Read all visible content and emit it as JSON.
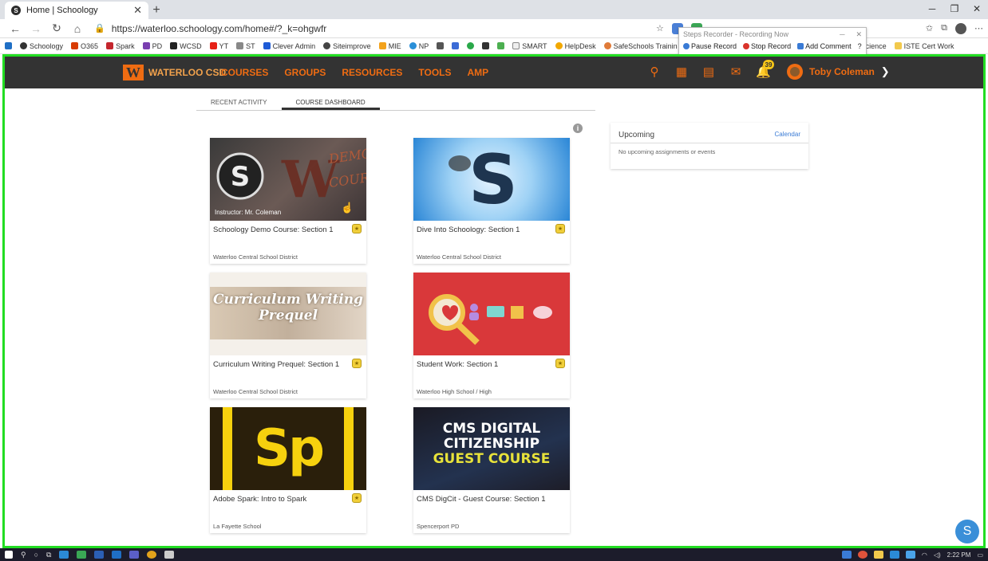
{
  "browser": {
    "tab_title": "Home | Schoology",
    "url": "https://waterloo.schoology.com/home#/?_k=ohgwfr",
    "bookmarks": [
      "Schoology",
      "O365",
      "Spark",
      "PD",
      "WCSD",
      "YT",
      "ST",
      "Clever Admin",
      "Siteimprove",
      "MIE",
      "NP",
      "SMART",
      "HelpDesk",
      "SafeSchools Trainin",
      "Science",
      "ISTE Cert Work"
    ]
  },
  "steps_recorder": {
    "title": "Steps Recorder - Recording Now",
    "pause": "Pause Record",
    "stop": "Stop Record",
    "comment": "Add Comment"
  },
  "header": {
    "logo_text": "WATERLOO CSD",
    "nav": [
      "COURSES",
      "GROUPS",
      "RESOURCES",
      "TOOLS",
      "AMP"
    ],
    "notifications_count": "39",
    "user_name": "Toby Coleman"
  },
  "tabs": [
    "RECENT ACTIVITY",
    "COURSE DASHBOARD"
  ],
  "courses": [
    {
      "title": "Schoology Demo Course: Section 1",
      "org": "Waterloo Central School District",
      "instructor": "Instructor: Mr. Coleman",
      "image": "demo-course"
    },
    {
      "title": "Dive Into Schoology: Section 1",
      "org": "Waterloo Central School District",
      "image": "dive-into-schoology"
    },
    {
      "title": "Curriculum Writing Prequel: Section 1",
      "org": "Waterloo Central School District",
      "image_text": "Curriculum Writing Prequel"
    },
    {
      "title": "Student Work: Section 1",
      "org": "Waterloo High School / High",
      "image": "student-work"
    },
    {
      "title": "Adobe Spark: Intro to Spark",
      "org": "La Fayette School",
      "image_text": "Sp"
    },
    {
      "title": "CMS DigCit - Guest Course: Section 1",
      "org": "Spencerport PD",
      "image_text": [
        "CMS DIGITAL",
        "CITIZENSHIP",
        "GUEST COURSE"
      ]
    }
  ],
  "upcoming": {
    "title": "Upcoming",
    "link": "Calendar",
    "empty": "No upcoming assignments or events"
  },
  "taskbar": {
    "time": "2:22 PM"
  },
  "colors": {
    "accent": "#ef6c12",
    "header_bg": "#333333",
    "frame": "#22dd22"
  }
}
